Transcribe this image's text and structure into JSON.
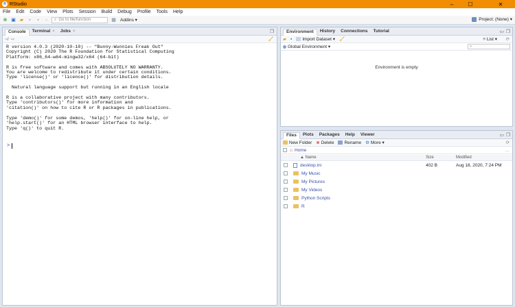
{
  "window": {
    "title": "RStudio",
    "app_icon": "R",
    "min": "–",
    "max": "☐",
    "close": "✕"
  },
  "menu": [
    "File",
    "Edit",
    "Code",
    "View",
    "Plots",
    "Session",
    "Build",
    "Debug",
    "Profile",
    "Tools",
    "Help"
  ],
  "toolbar": {
    "goto_placeholder": "Go to file/function",
    "addins_label": "Addins ▾",
    "project_label": "Project: (None) ▾"
  },
  "console": {
    "tabs": [
      "Console",
      "Terminal",
      "Jobs"
    ],
    "path": "~/",
    "text": "R version 4.0.3 (2020-10-10) -- \"Bunny-Wunnies Freak Out\"\nCopyright (C) 2020 The R Foundation for Statistical Computing\nPlatform: x86_64-w64-mingw32/x64 (64-bit)\n\nR is free software and comes with ABSOLUTELY NO WARRANTY.\nYou are welcome to redistribute it under certain conditions.\nType 'license()' or 'licence()' for distribution details.\n\n  Natural language support but running in an English locale\n\nR is a collaborative project with many contributors.\nType 'contributors()' for more information and\n'citation()' on how to cite R or R packages in publications.\n\nType 'demo()' for some demos, 'help()' for on-line help, or\n'help.start()' for an HTML browser interface to help.\nType 'q()' to quit R.",
    "prompt": ">"
  },
  "environment": {
    "tabs": [
      "Environment",
      "History",
      "Connections",
      "Tutorial"
    ],
    "import_label": "Import Dataset ▾",
    "list_label": "List ▾",
    "scope_label": "Global Environment ▾",
    "search_placeholder": "",
    "empty_message": "Environment is empty"
  },
  "files": {
    "tabs": [
      "Files",
      "Plots",
      "Packages",
      "Help",
      "Viewer"
    ],
    "actions": {
      "new_folder": "New Folder",
      "delete": "Delete",
      "rename": "Rename",
      "more": "More ▾"
    },
    "breadcrumb": "Home",
    "columns": {
      "name": "▲ Name",
      "size": "Size",
      "modified": "Modified"
    },
    "rows": [
      {
        "name": "desktop.ini",
        "size": "402 B",
        "modified": "Aug 18, 2020, 7:24 PM",
        "type": "file"
      },
      {
        "name": "My Music",
        "size": "",
        "modified": "",
        "type": "folder"
      },
      {
        "name": "My Pictures",
        "size": "",
        "modified": "",
        "type": "folder"
      },
      {
        "name": "My Videos",
        "size": "",
        "modified": "",
        "type": "folder"
      },
      {
        "name": "Python Scripts",
        "size": "",
        "modified": "",
        "type": "folder"
      },
      {
        "name": "R",
        "size": "",
        "modified": "",
        "type": "folder"
      }
    ]
  },
  "colors": {
    "titlebar": "#f28c00",
    "link": "#3a4da8",
    "folder": "#e9c261"
  }
}
